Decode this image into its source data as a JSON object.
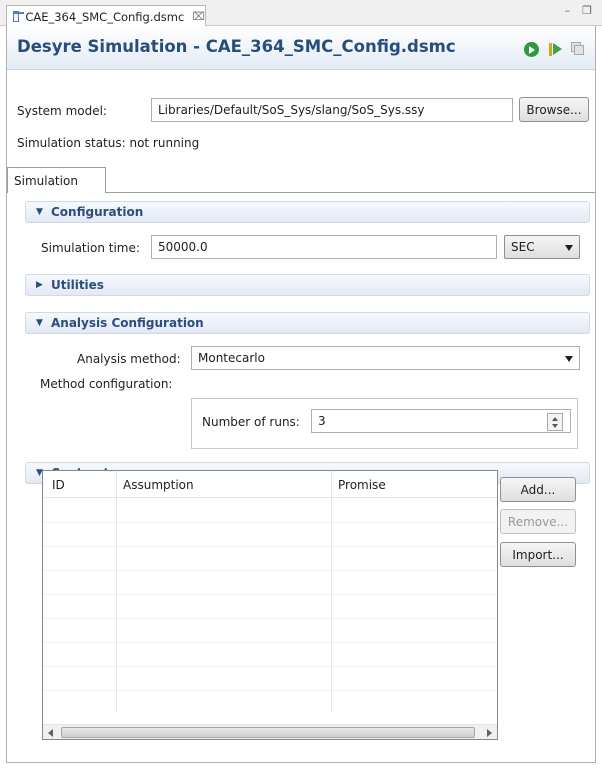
{
  "tab": {
    "title": "CAE_364_SMC_Config.dsmc",
    "close_glyph": "⌧",
    "minimize_glyph": "–",
    "maximize_glyph": "❐"
  },
  "header": {
    "title": "Desyre Simulation - CAE_364_SMC_Config.dsmc"
  },
  "system_model": {
    "label": "System model:",
    "value": "Libraries/Default/SoS_Sys/slang/SoS_Sys.ssy",
    "browse_label": "Browse..."
  },
  "status": {
    "text": "Simulation status: not running"
  },
  "inner_tab": {
    "label": "Simulation"
  },
  "configuration": {
    "title": "Configuration",
    "sim_time_label": "Simulation time:",
    "sim_time_value": "50000.0",
    "unit": "SEC"
  },
  "utilities": {
    "title": "Utilities"
  },
  "analysis": {
    "title": "Analysis Configuration",
    "method_label": "Analysis method:",
    "method_value": "Montecarlo",
    "method_config_label": "Method configuration:",
    "runs_label": "Number of runs:",
    "runs_value": "3"
  },
  "contracts": {
    "title": "Contracts",
    "columns": [
      "ID",
      "Assumption",
      "Promise"
    ],
    "rows": [],
    "buttons": {
      "add": "Add...",
      "remove": "Remove...",
      "import": "Import..."
    }
  },
  "icons": {
    "run": "run-icon",
    "resume": "resume-icon",
    "stop": "stop-icon",
    "file": "file-icon"
  },
  "colors": {
    "header_text": "#274d7d",
    "section_text": "#2a4e80",
    "run_green": "#2e9a3a"
  }
}
